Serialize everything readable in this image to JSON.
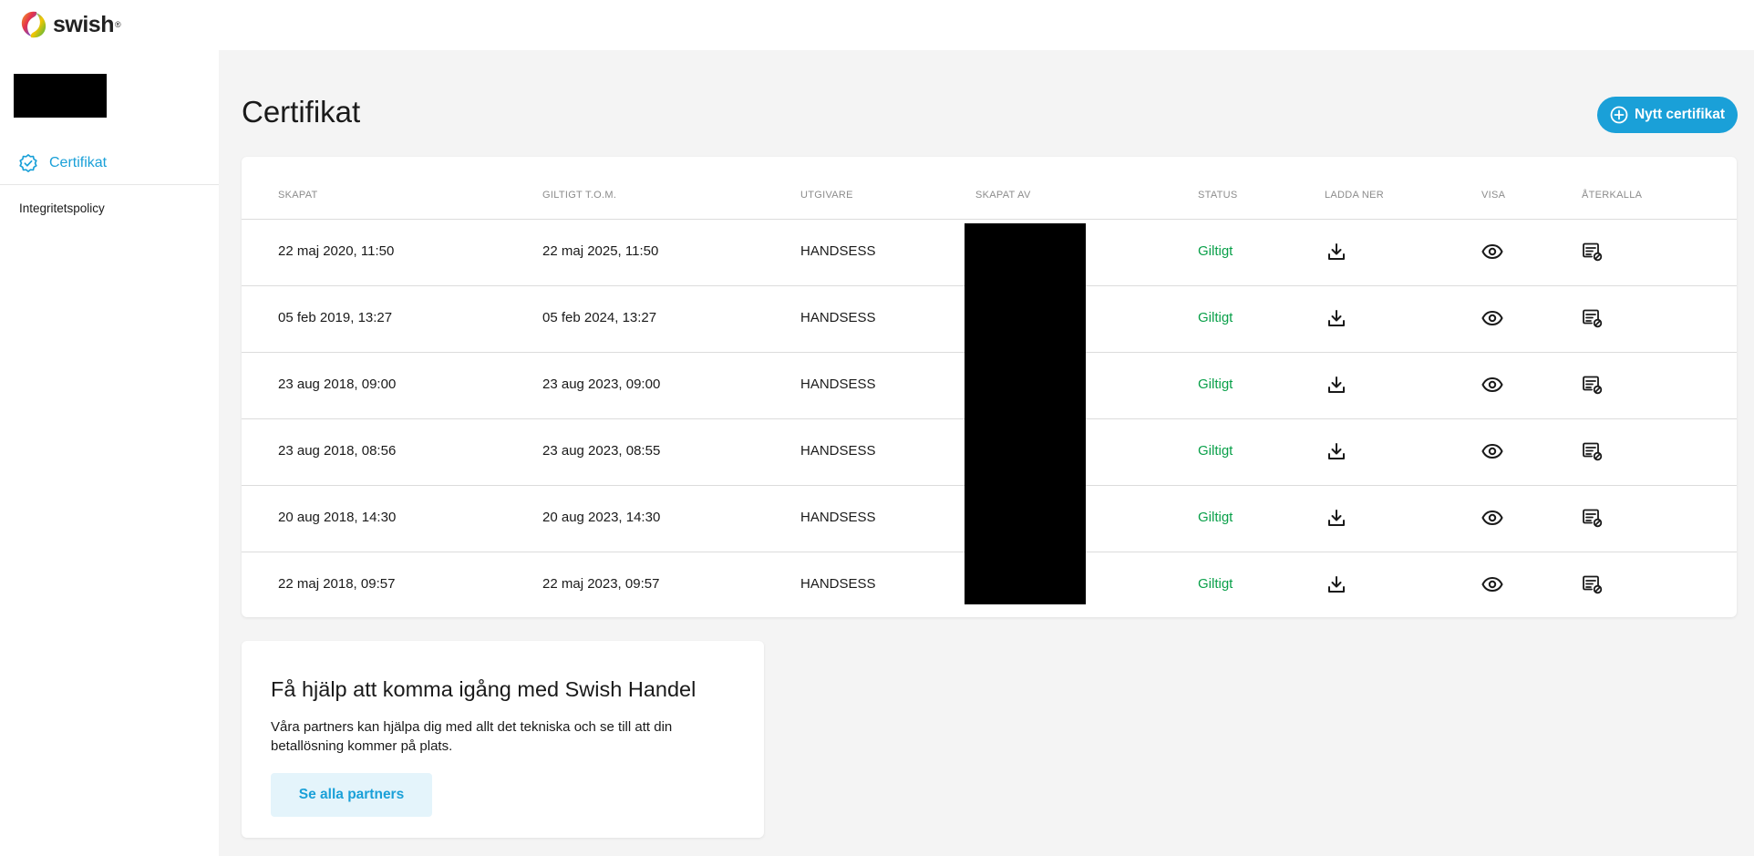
{
  "brand": {
    "name": "swish",
    "reg_mark": "®"
  },
  "sidebar": {
    "nav_active": {
      "label": "Certifikat"
    },
    "footer_link": "Integritetspolicy"
  },
  "page": {
    "title": "Certifikat",
    "new_button": "Nytt certifikat"
  },
  "table": {
    "headers": {
      "created": "SKAPAT",
      "valid_until": "GILTIGT T.O.M.",
      "issuer": "UTGIVARE",
      "created_by": "SKAPAT AV",
      "status": "STATUS",
      "download": "LADDA NER",
      "view": "VISA",
      "revoke": "ÅTERKALLA"
    },
    "rows": [
      {
        "created": "22 maj 2020, 11:50",
        "valid_until": "22 maj 2025, 11:50",
        "issuer": "HANDSESS",
        "status": "Giltigt"
      },
      {
        "created": "05 feb 2019, 13:27",
        "valid_until": "05 feb 2024, 13:27",
        "issuer": "HANDSESS",
        "status": "Giltigt"
      },
      {
        "created": "23 aug 2018, 09:00",
        "valid_until": "23 aug 2023, 09:00",
        "issuer": "HANDSESS",
        "status": "Giltigt"
      },
      {
        "created": "23 aug 2018, 08:56",
        "valid_until": "23 aug 2023, 08:55",
        "issuer": "HANDSESS",
        "status": "Giltigt"
      },
      {
        "created": "20 aug 2018, 14:30",
        "valid_until": "20 aug 2023, 14:30",
        "issuer": "HANDSESS",
        "status": "Giltigt"
      },
      {
        "created": "22 maj 2018, 09:57",
        "valid_until": "22 maj 2023, 09:57",
        "issuer": "HANDSESS",
        "status": "Giltigt"
      }
    ]
  },
  "help": {
    "title": "Få hjälp att komma igång med Swish Handel",
    "text": "Våra partners kan hjälpa dig med allt det tekniska och se till att din betallösning kommer på plats.",
    "button": "Se alla partners"
  },
  "colors": {
    "accent": "#1aa0d8",
    "valid": "#0aa04a",
    "background": "#f4f4f4"
  },
  "icons": {
    "brand": "swish-logo-icon",
    "nav": "badge-check-icon",
    "new": "plus-circle-icon",
    "download": "download-icon",
    "view": "eye-icon",
    "revoke": "revoke-certificate-icon"
  }
}
